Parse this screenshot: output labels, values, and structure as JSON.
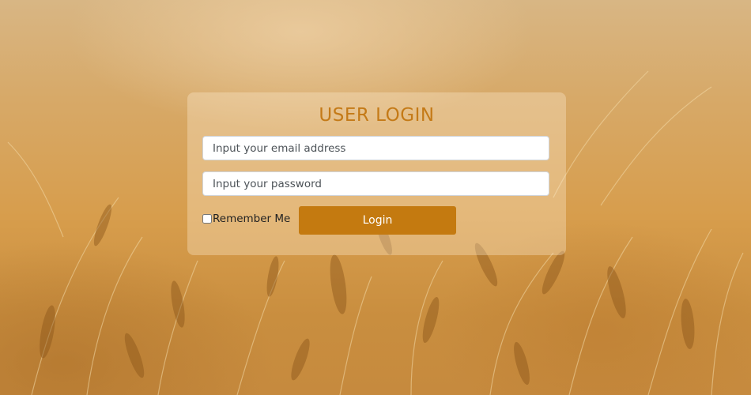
{
  "login_form": {
    "title": "USER LOGIN",
    "email_placeholder": "Input your email address",
    "password_placeholder": "Input your password",
    "remember_label": "Remember Me",
    "login_label": "Login"
  },
  "colors": {
    "accent": "#c47a10",
    "title": "#c47a17",
    "background": "#d79d4c"
  }
}
